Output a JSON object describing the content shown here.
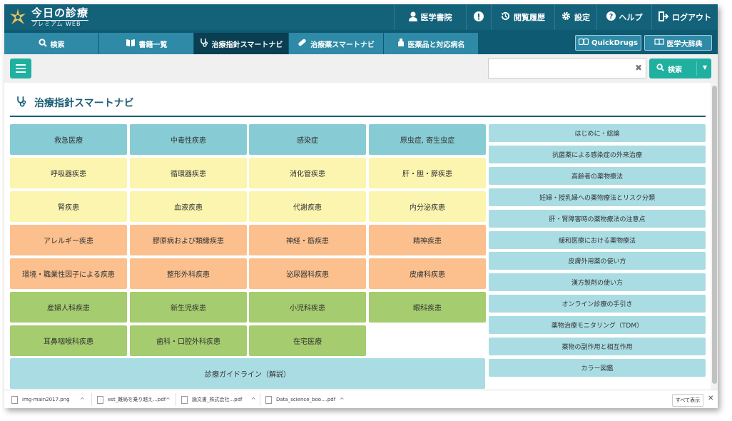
{
  "header": {
    "logo_main": "今日の診療",
    "logo_sub": "プレミアム WEB",
    "nav": [
      {
        "label": "医学書院",
        "icon": "user-icon"
      },
      {
        "label": "",
        "icon": "alert-icon"
      },
      {
        "label": "閲覧履歴",
        "icon": "history-icon"
      },
      {
        "label": "設定",
        "icon": "gear-icon"
      },
      {
        "label": "ヘルプ",
        "icon": "help-icon"
      },
      {
        "label": "ログアウト",
        "icon": "logout-icon"
      }
    ]
  },
  "tabs": [
    {
      "label": "検索",
      "icon": "search-icon"
    },
    {
      "label": "書籍一覧",
      "icon": "book-icon"
    },
    {
      "label": "治療指針スマートナビ",
      "icon": "stethoscope-icon",
      "active": true
    },
    {
      "label": "治療薬スマートナビ",
      "icon": "pill-icon"
    },
    {
      "label": "医薬品と対応病名",
      "icon": "bottle-icon"
    }
  ],
  "ext_buttons": {
    "quickdrugs": "QuickDrugs",
    "dictionary": "医学大辞典"
  },
  "search": {
    "value": "",
    "button_label": "検索"
  },
  "page_title": "治療指針スマートナビ",
  "grid": [
    [
      "救急医療",
      "中毒性疾患",
      "感染症",
      "原虫症, 寄生虫症"
    ],
    [
      "呼吸器疾患",
      "循環器疾患",
      "消化管疾患",
      "肝・胆・膵疾患"
    ],
    [
      "腎疾患",
      "血液疾患",
      "代謝疾患",
      "内分泌疾患"
    ],
    [
      "アレルギー疾患",
      "膠原病および類縁疾患",
      "神経・筋疾患",
      "精神疾患"
    ],
    [
      "環境・職業性因子による疾患",
      "整形外科疾患",
      "泌尿器科疾患",
      "皮膚科疾患"
    ],
    [
      "産婦人科疾患",
      "新生児疾患",
      "小児科疾患",
      "眼科疾患"
    ],
    [
      "耳鼻咽喉科疾患",
      "歯科・口腔外科疾患",
      "在宅医療"
    ]
  ],
  "guideline": "診療ガイドライン（解説）",
  "colors": {
    "blue": "#87ccd4",
    "yellow": "#fbf5b0",
    "orange": "#fbc08e",
    "green": "#a5cc6e",
    "light": "#a9dde3"
  },
  "side_links": [
    "はじめに・総論",
    "抗菌薬による感染症の外来治療",
    "高齢者の薬物療法",
    "妊婦・授乳婦への薬物療法とリスク分類",
    "肝・腎障害時の薬物療法の注意点",
    "緩和医療における薬物療法",
    "皮膚外用薬の使い方",
    "漢方製剤の使い方",
    "オンライン診療の手引き",
    "薬物治療モニタリング（TDM）",
    "薬物の副作用と相互作用",
    "カラー図鑑"
  ],
  "downloads": [
    "img-main2017.png",
    "est_難局を乗り越え...pdf",
    "論文書_株式会社...pdf",
    "Data_science_boo....pdf"
  ],
  "download_showall": "すべて表示"
}
